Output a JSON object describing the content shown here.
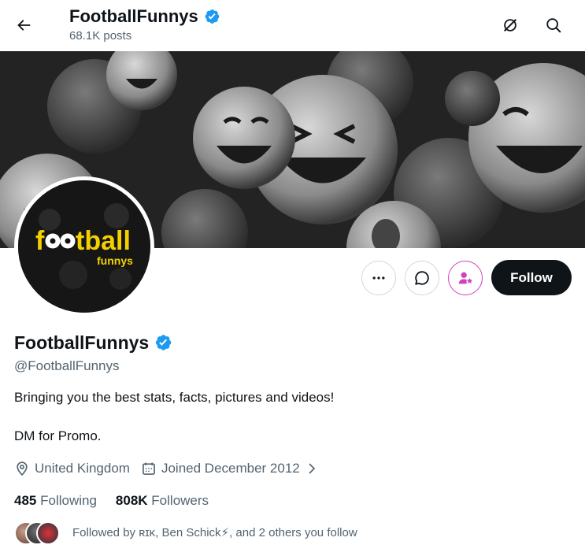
{
  "header": {
    "title": "FootballFunnys",
    "posts": "68.1K posts"
  },
  "logo": {
    "line1": "football",
    "line2": "funnys",
    "color": "#f5d000"
  },
  "actions": {
    "follow_label": "Follow"
  },
  "profile": {
    "name": "FootballFunnys",
    "handle": "@FootballFunnys",
    "bio_line1": "Bringing you the best stats, facts, pictures and videos!",
    "bio_line2": "DM for Promo.",
    "location": "United Kingdom",
    "joined": "Joined December 2012",
    "following_count": "485",
    "following_label": "Following",
    "followers_count": "808K",
    "followers_label": "Followers",
    "followed_by": "Followed by ʀɪᴋ, Ben Schick⚡, and 2 others you follow"
  },
  "colors": {
    "verified": "#1d9bf0",
    "follow_bg": "#0f1419",
    "secondary_text": "#536471",
    "subscribe_accent": "#d040c0"
  },
  "icons": [
    "back-arrow-icon",
    "verified-badge-icon",
    "grok-icon",
    "search-icon",
    "more-icon",
    "message-icon",
    "subscribe-icon",
    "location-icon",
    "calendar-icon",
    "chevron-right-icon"
  ]
}
